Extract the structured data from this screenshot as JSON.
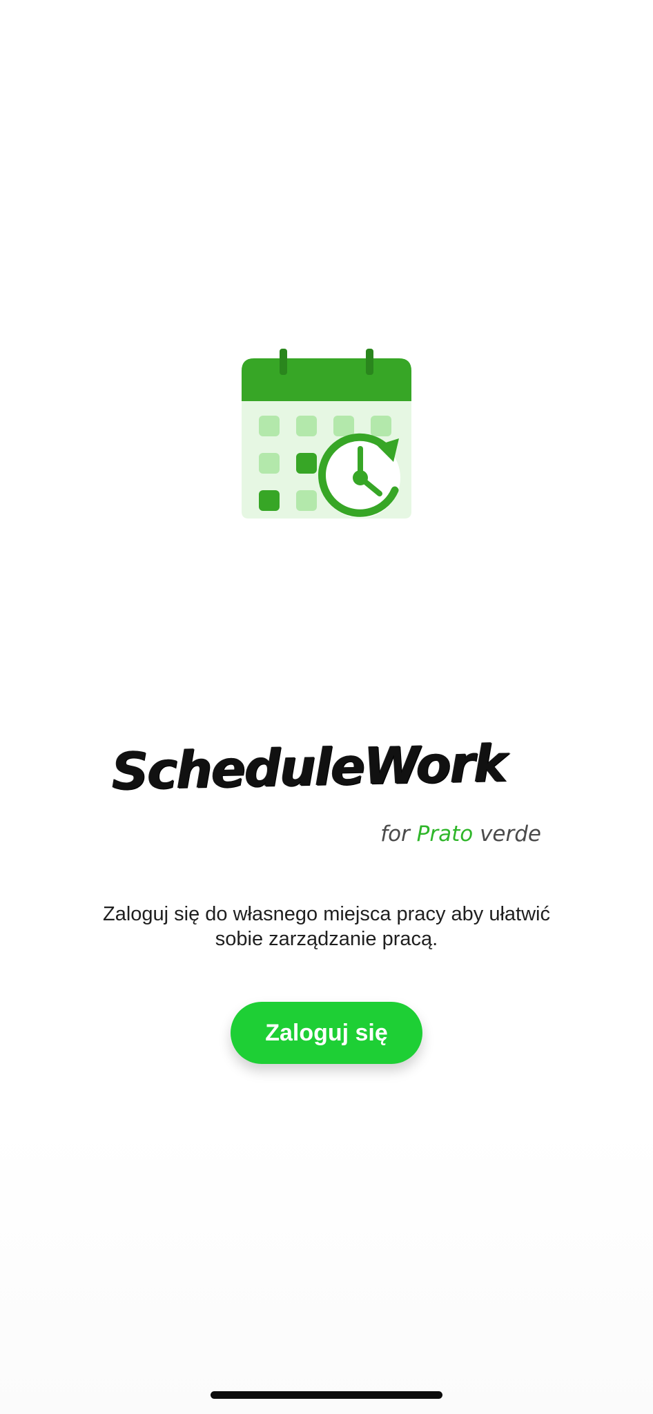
{
  "app": {
    "logo_icon": "calendar-clock-icon",
    "wordmark": {
      "title": "ScheduleWork",
      "sub_prefix": "for",
      "sub_accent": "Prato",
      "sub_suffix": "verde"
    },
    "tagline_line1": "Zaloguj się do własnego miejsca pracy aby ułatwić",
    "tagline_line2": "sobie zarządzanie pracą.",
    "login_label": "Zaloguj się"
  },
  "colors": {
    "brand_green": "#37a626",
    "light_green": "#e6f7e3",
    "button_green": "#1ecf35",
    "accent_text": "#2fb62a"
  }
}
